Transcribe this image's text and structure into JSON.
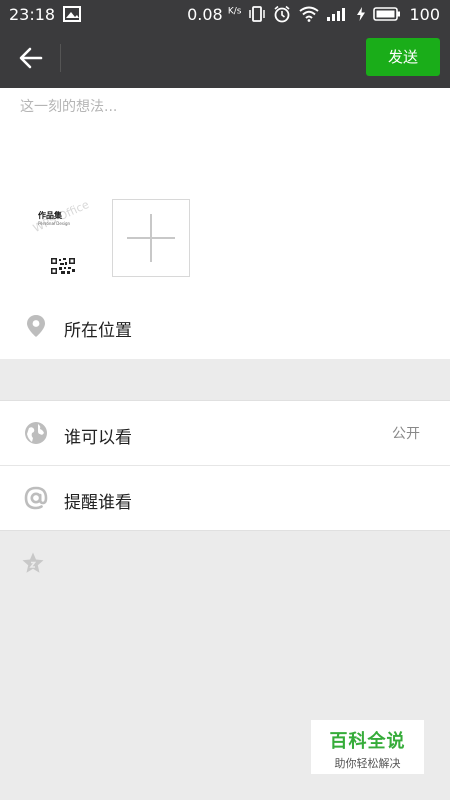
{
  "status_bar": {
    "time": "23:18",
    "speed_value": "0.08",
    "speed_unit": "K/s",
    "battery": "100"
  },
  "header": {
    "send_label": "发送"
  },
  "compose": {
    "placeholder": "这一刻的想法...",
    "image_title": "作品集",
    "image_subtitle": "Personal Design",
    "image_watermark": "WPS Office"
  },
  "location": {
    "label": "所在位置"
  },
  "visibility": {
    "label": "谁可以看",
    "value": "公开"
  },
  "mention": {
    "label": "提醒谁看"
  },
  "watermark": {
    "title": "百科全说",
    "subtitle": "助你轻松解决"
  },
  "colors": {
    "bar": "#3b3b3d",
    "accent": "#1aad19",
    "page_bg": "#ebebeb"
  },
  "icons": [
    "arrow-left-icon",
    "location-pin-icon",
    "globe-icon",
    "at-icon",
    "star-icon",
    "wifi-icon",
    "signal-icon",
    "battery-icon",
    "alarm-icon",
    "vibrate-icon",
    "image-icon",
    "bolt-icon"
  ]
}
